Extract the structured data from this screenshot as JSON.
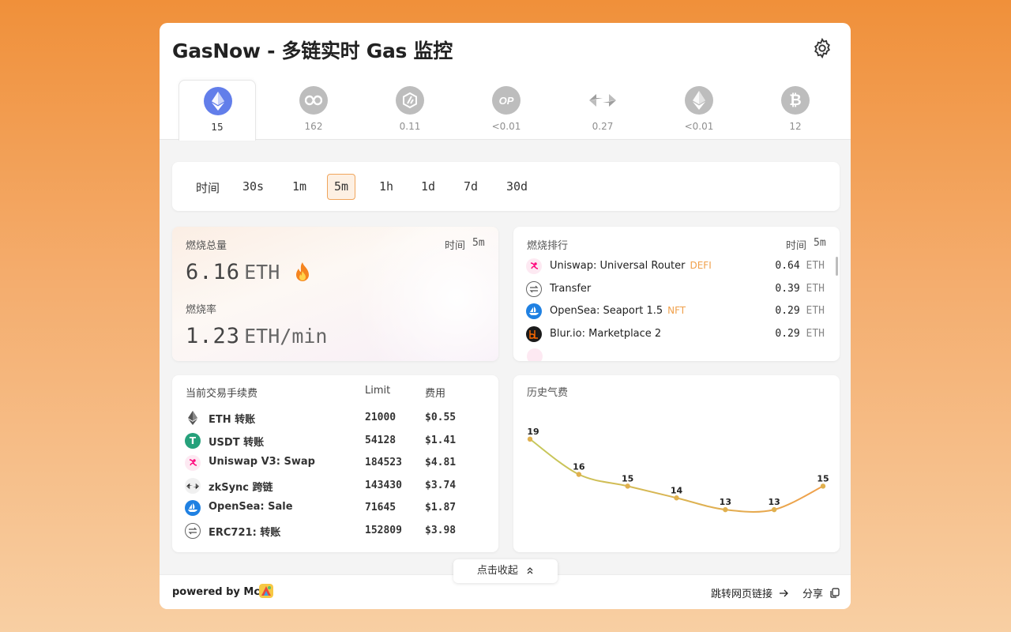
{
  "app": {
    "title": "GasNow - 多链实时 Gas 监控"
  },
  "chains": [
    {
      "name": "Ethereum",
      "icon": "ethereum-icon",
      "value": "15",
      "active": true
    },
    {
      "name": "Polygon",
      "icon": "polygon-icon",
      "value": "162"
    },
    {
      "name": "Arbitrum",
      "icon": "arbitrum-icon",
      "value": "0.11"
    },
    {
      "name": "Optimism",
      "icon": "optimism-icon",
      "value": "<0.01"
    },
    {
      "name": "zkSync",
      "icon": "zksync-icon",
      "value": "0.27"
    },
    {
      "name": "Goerli",
      "icon": "ethereum-gray-icon",
      "value": "<0.01"
    },
    {
      "name": "Bitcoin",
      "icon": "bitcoin-icon",
      "value": "12"
    }
  ],
  "time_filter": {
    "label": "时间",
    "options": [
      "30s",
      "1m",
      "5m",
      "1h",
      "1d",
      "7d",
      "30d"
    ],
    "selected": "5m"
  },
  "burn": {
    "total_label": "燃烧总量",
    "time_label": "时间",
    "time_value": "5m",
    "total_value": "6.16",
    "total_unit": "ETH",
    "rate_label": "燃烧率",
    "rate_value": "1.23",
    "rate_unit": "ETH/min"
  },
  "ranking": {
    "title": "燃烧排行",
    "time_label": "时间",
    "time_value": "5m",
    "rows": [
      {
        "name": "Uniswap: Universal Router",
        "tag": "DEFI",
        "value": "0.64",
        "unit": "ETH",
        "icon": "uniswap-icon"
      },
      {
        "name": "Transfer",
        "tag": "",
        "value": "0.39",
        "unit": "ETH",
        "icon": "transfer-icon"
      },
      {
        "name": "OpenSea: Seaport 1.5",
        "tag": "NFT",
        "value": "0.29",
        "unit": "ETH",
        "icon": "opensea-icon"
      },
      {
        "name": "Blur.io: Marketplace 2",
        "tag": "",
        "value": "0.29",
        "unit": "ETH",
        "icon": "blur-icon"
      }
    ]
  },
  "fees": {
    "title": "当前交易手续费",
    "col_limit": "Limit",
    "col_cost": "费用",
    "rows": [
      {
        "name": "ETH 转账",
        "limit": "21000",
        "cost": "$0.55",
        "icon": "ethereum-icon"
      },
      {
        "name": "USDT 转账",
        "limit": "54128",
        "cost": "$1.41",
        "icon": "tether-icon"
      },
      {
        "name": "Uniswap V3: Swap",
        "limit": "184523",
        "cost": "$4.81",
        "icon": "uniswap-icon"
      },
      {
        "name": "zkSync 跨链",
        "limit": "143430",
        "cost": "$3.74",
        "icon": "zksync-icon"
      },
      {
        "name": "OpenSea: Sale",
        "limit": "71645",
        "cost": "$1.87",
        "icon": "opensea-icon"
      },
      {
        "name": "ERC721: 转账",
        "limit": "152809",
        "cost": "$3.98",
        "icon": "transfer-icon"
      }
    ]
  },
  "chart_data": {
    "type": "line",
    "title": "历史气费",
    "x": [
      "1",
      "2",
      "3",
      "4",
      "5",
      "6",
      "7"
    ],
    "series": [
      {
        "values": [
          19,
          16,
          15,
          14,
          13,
          13,
          15
        ]
      }
    ],
    "ylim": [
      12,
      20
    ],
    "grid": false,
    "colors": {
      "start": "#c5c85a",
      "end": "#f0a04b",
      "point": "#e0b04e"
    }
  },
  "footer": {
    "collapse": "点击收起",
    "powered": "powered by Mct",
    "jump": "跳转网页链接",
    "share": "分享"
  },
  "colors": {
    "accent": "#f0a04b",
    "eth": "#627eea",
    "tether": "#26a17b",
    "opensea": "#2081e2"
  }
}
